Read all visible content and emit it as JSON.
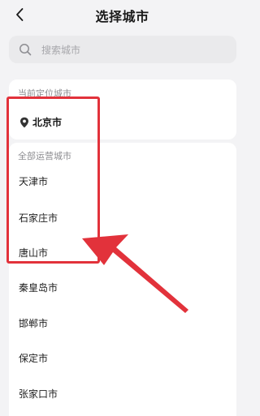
{
  "header": {
    "title": "选择城市"
  },
  "search": {
    "placeholder": "搜索城市"
  },
  "location": {
    "section_label": "当前定位城市",
    "city": "北京市"
  },
  "cities": {
    "section_label": "全部运营城市",
    "items": [
      "天津市",
      "石家庄市",
      "唐山市",
      "秦皇岛市",
      "邯郸市",
      "保定市",
      "张家口市"
    ]
  },
  "colors": {
    "highlight": "#e2323b",
    "background": "#f3f3f5",
    "card": "#ffffff"
  },
  "icons": {
    "back": "chevron-left-icon",
    "search": "search-icon",
    "location": "location-pin-icon"
  }
}
